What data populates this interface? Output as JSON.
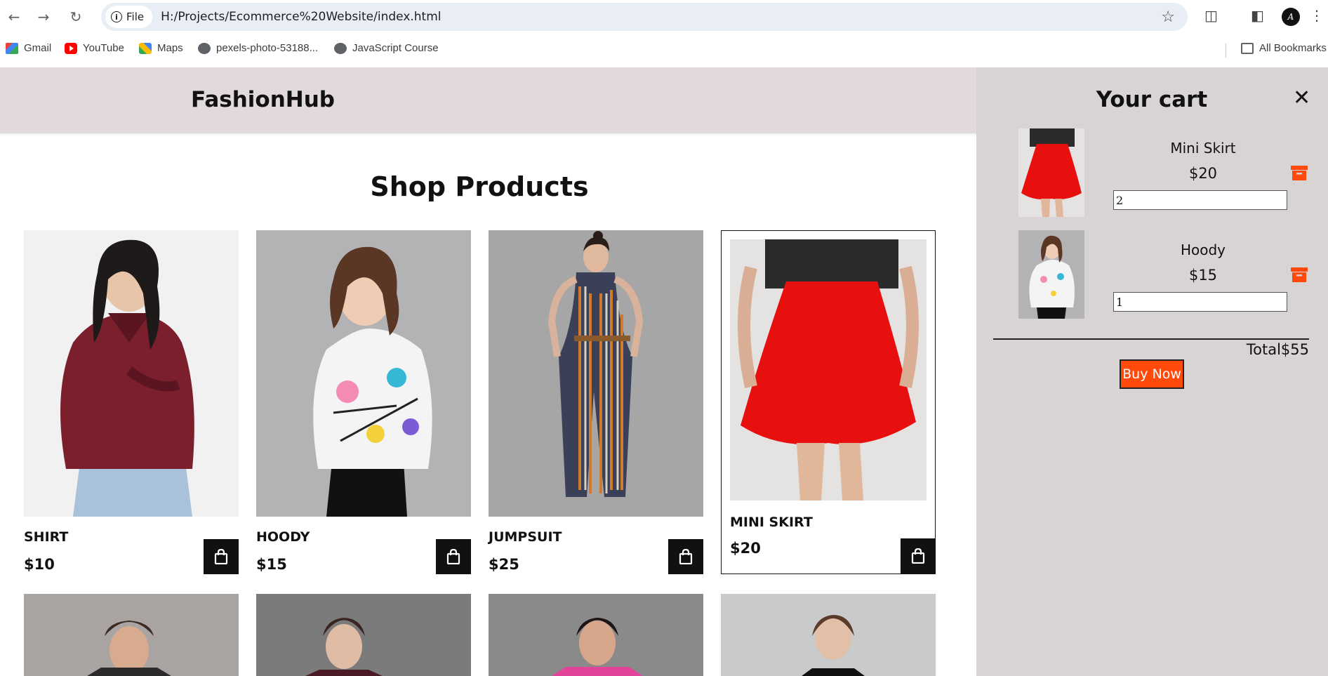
{
  "browser": {
    "file_label": "File",
    "url": "H:/Projects/Ecommerce%20Website/index.html",
    "bookmarks": [
      {
        "label": "Gmail",
        "icon": "gmail-icon"
      },
      {
        "label": "YouTube",
        "icon": "youtube-icon"
      },
      {
        "label": "Maps",
        "icon": "maps-icon"
      },
      {
        "label": "pexels-photo-53188...",
        "icon": "globe-icon"
      },
      {
        "label": "JavaScript Course",
        "icon": "globe-icon"
      }
    ],
    "all_bookmarks_label": "All Bookmarks"
  },
  "header": {
    "logo": "FashionHub"
  },
  "shop": {
    "title": "Shop Products",
    "products": [
      {
        "name": "SHIRT",
        "price": "$10"
      },
      {
        "name": "HOODY",
        "price": "$15"
      },
      {
        "name": "JUMPSUIT",
        "price": "$25"
      },
      {
        "name": "MINI SKIRT",
        "price": "$20"
      }
    ]
  },
  "cart": {
    "title": "Your cart",
    "items": [
      {
        "name": "Mini Skirt",
        "price": "$20",
        "quantity": "2"
      },
      {
        "name": "Hoody",
        "price": "$15",
        "quantity": "1"
      }
    ],
    "total_label": "Total",
    "total_value": "$55",
    "buy_label": "Buy Now"
  },
  "colors": {
    "header_bg": "#e2dada",
    "cart_bg": "#d9d4d4",
    "buy_button": "#ff4a0b",
    "trash": "#ff4a0b"
  }
}
